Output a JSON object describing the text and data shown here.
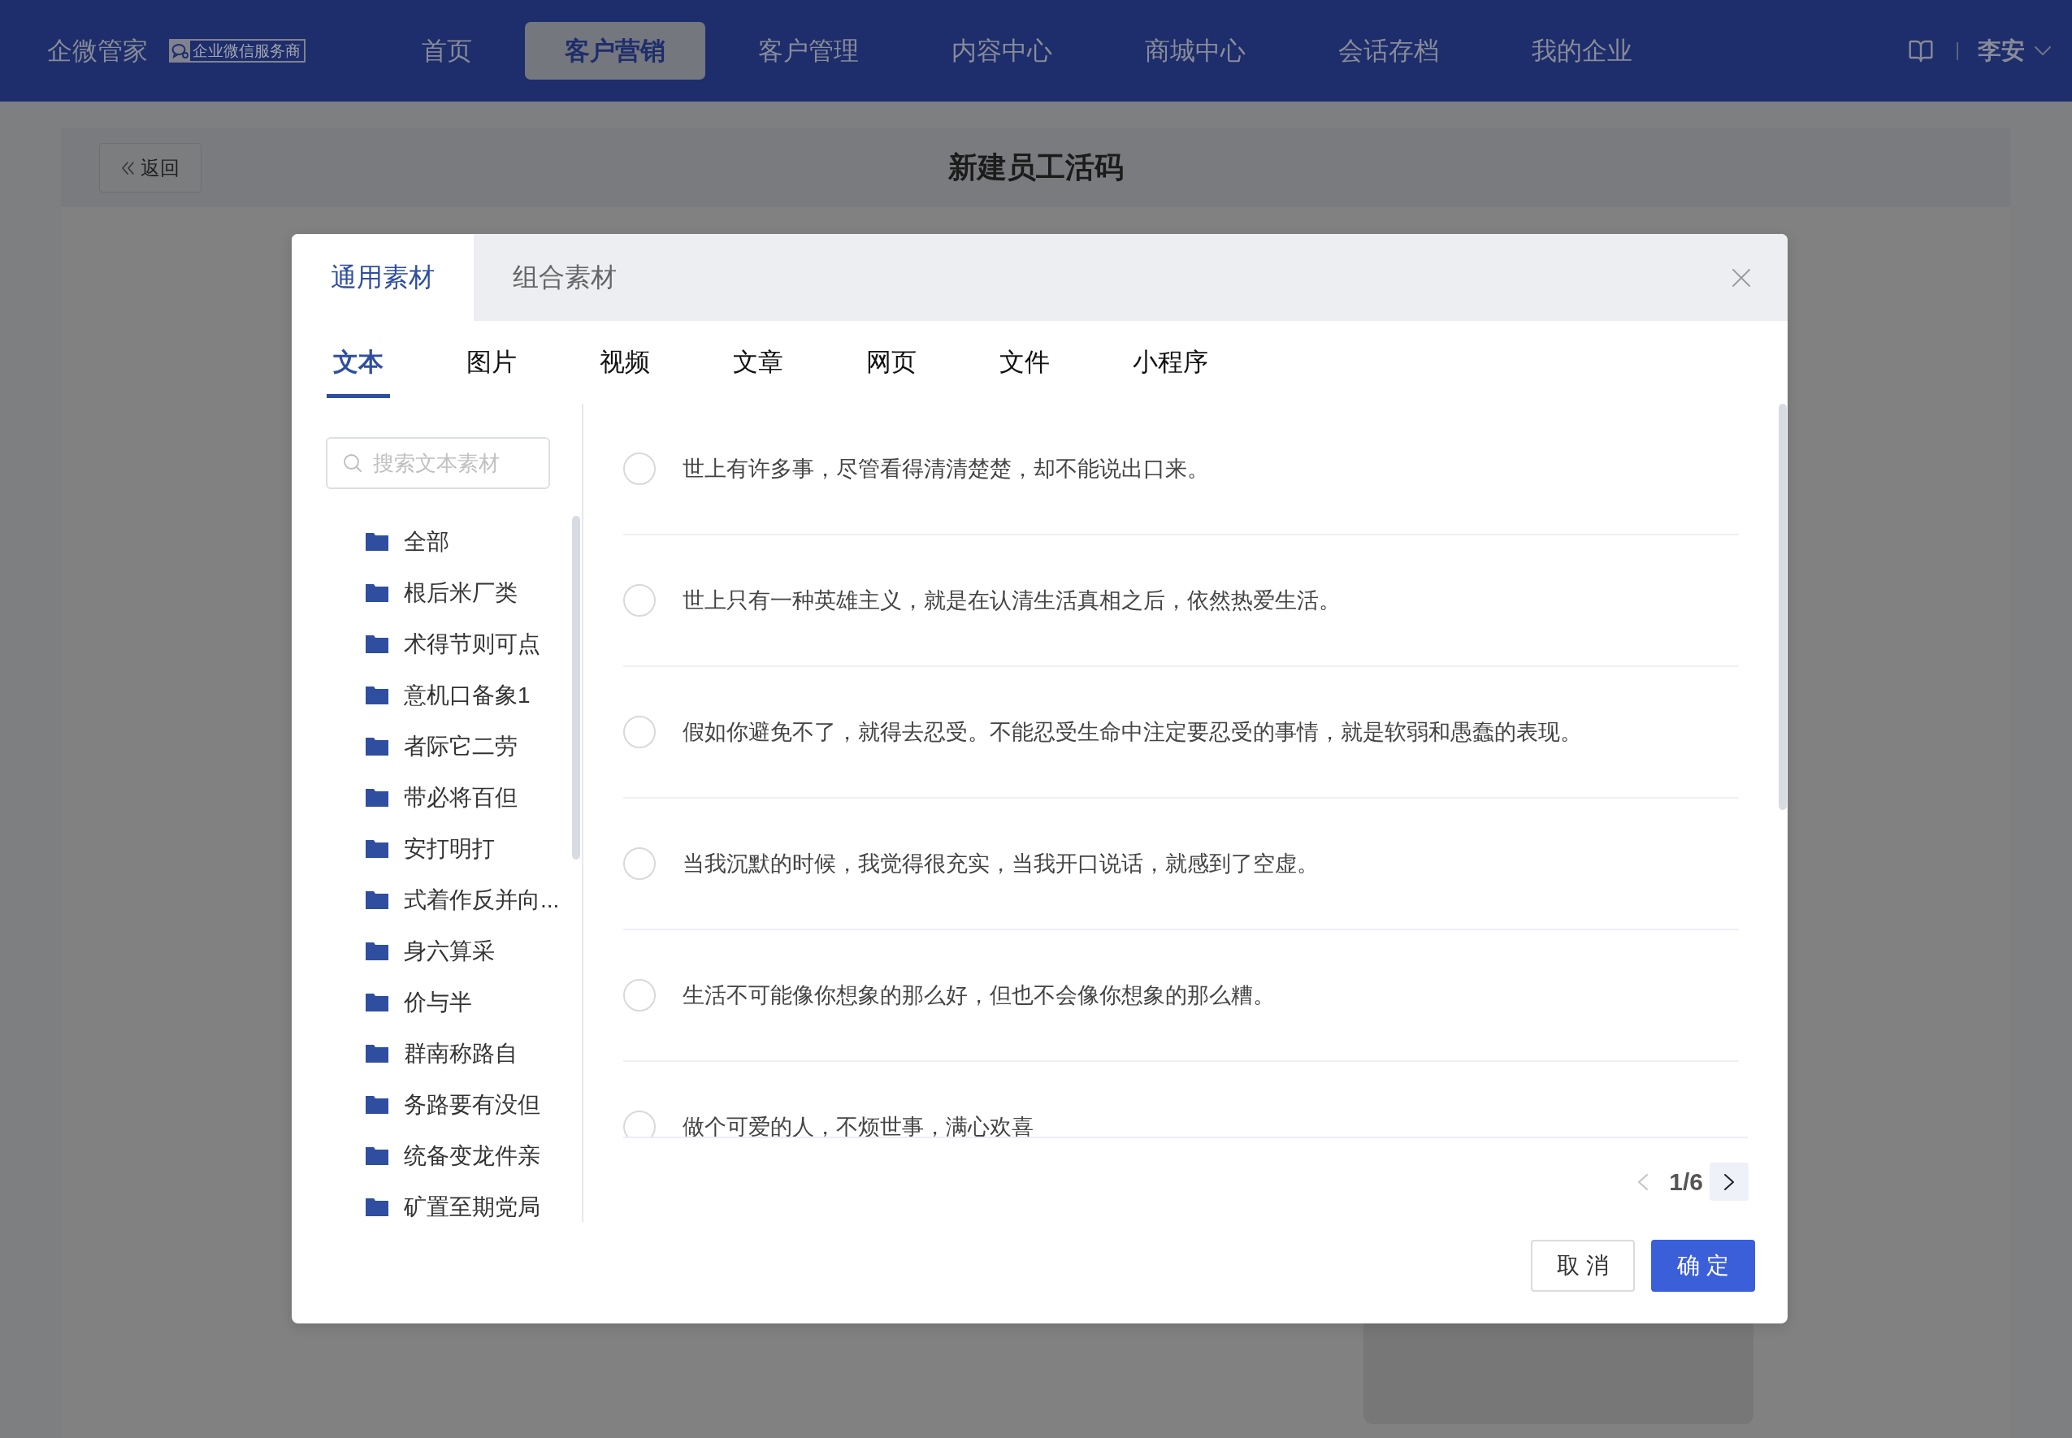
{
  "header": {
    "logo": "企微管家",
    "badge": "企业微信服务商",
    "nav": [
      {
        "label": "首页",
        "selected": false
      },
      {
        "label": "客户营销",
        "selected": true
      },
      {
        "label": "客户管理",
        "selected": false
      },
      {
        "label": "内容中心",
        "selected": false
      },
      {
        "label": "商城中心",
        "selected": false
      },
      {
        "label": "会话存档",
        "selected": false
      },
      {
        "label": "我的企业",
        "selected": false
      }
    ],
    "user": "李安"
  },
  "page": {
    "back_button": "返回",
    "title": "新建员工活码"
  },
  "dialog": {
    "tabs": [
      {
        "label": "通用素材",
        "selected": true
      },
      {
        "label": "组合素材",
        "selected": false
      }
    ],
    "type_tabs": [
      {
        "label": "文本",
        "selected": true
      },
      {
        "label": "图片",
        "selected": false
      },
      {
        "label": "视频",
        "selected": false
      },
      {
        "label": "文章",
        "selected": false
      },
      {
        "label": "网页",
        "selected": false
      },
      {
        "label": "文件",
        "selected": false
      },
      {
        "label": "小程序",
        "selected": false
      }
    ],
    "search": {
      "placeholder": "搜索文本素材"
    },
    "folders": [
      "全部",
      "根后米厂类",
      "术得节则可点",
      "意机口备象1",
      "者际它二劳",
      "带必将百但",
      "安打明打",
      "式着作反并向...",
      "身六算采",
      "价与半",
      "群南称路自",
      "务路要有没但",
      "统备变龙件亲",
      "矿置至期党局"
    ],
    "items": [
      {
        "text": "世上有许多事，尽管看得清清楚楚，却不能说出口来。",
        "selected": false
      },
      {
        "text": "世上只有一种英雄主义，就是在认清生活真相之后，依然热爱生活。",
        "selected": false
      },
      {
        "text": "假如你避免不了，就得去忍受。不能忍受生命中注定要忍受的事情，就是软弱和愚蠢的表现。",
        "selected": false
      },
      {
        "text": "当我沉默的时候，我觉得很充实，当我开口说话，就感到了空虚。",
        "selected": false
      },
      {
        "text": "生活不可能像你想象的那么好，但也不会像你想象的那么糟。",
        "selected": false
      },
      {
        "text": "做个可爱的人，不烦世事，满心欢喜",
        "selected": false
      }
    ],
    "pagination": {
      "page": "1/6",
      "prev_disabled": true,
      "next_disabled": false
    },
    "buttons": [
      {
        "label": "取 消",
        "kind": "secondary"
      },
      {
        "label": "确 定",
        "kind": "primary"
      }
    ]
  }
}
